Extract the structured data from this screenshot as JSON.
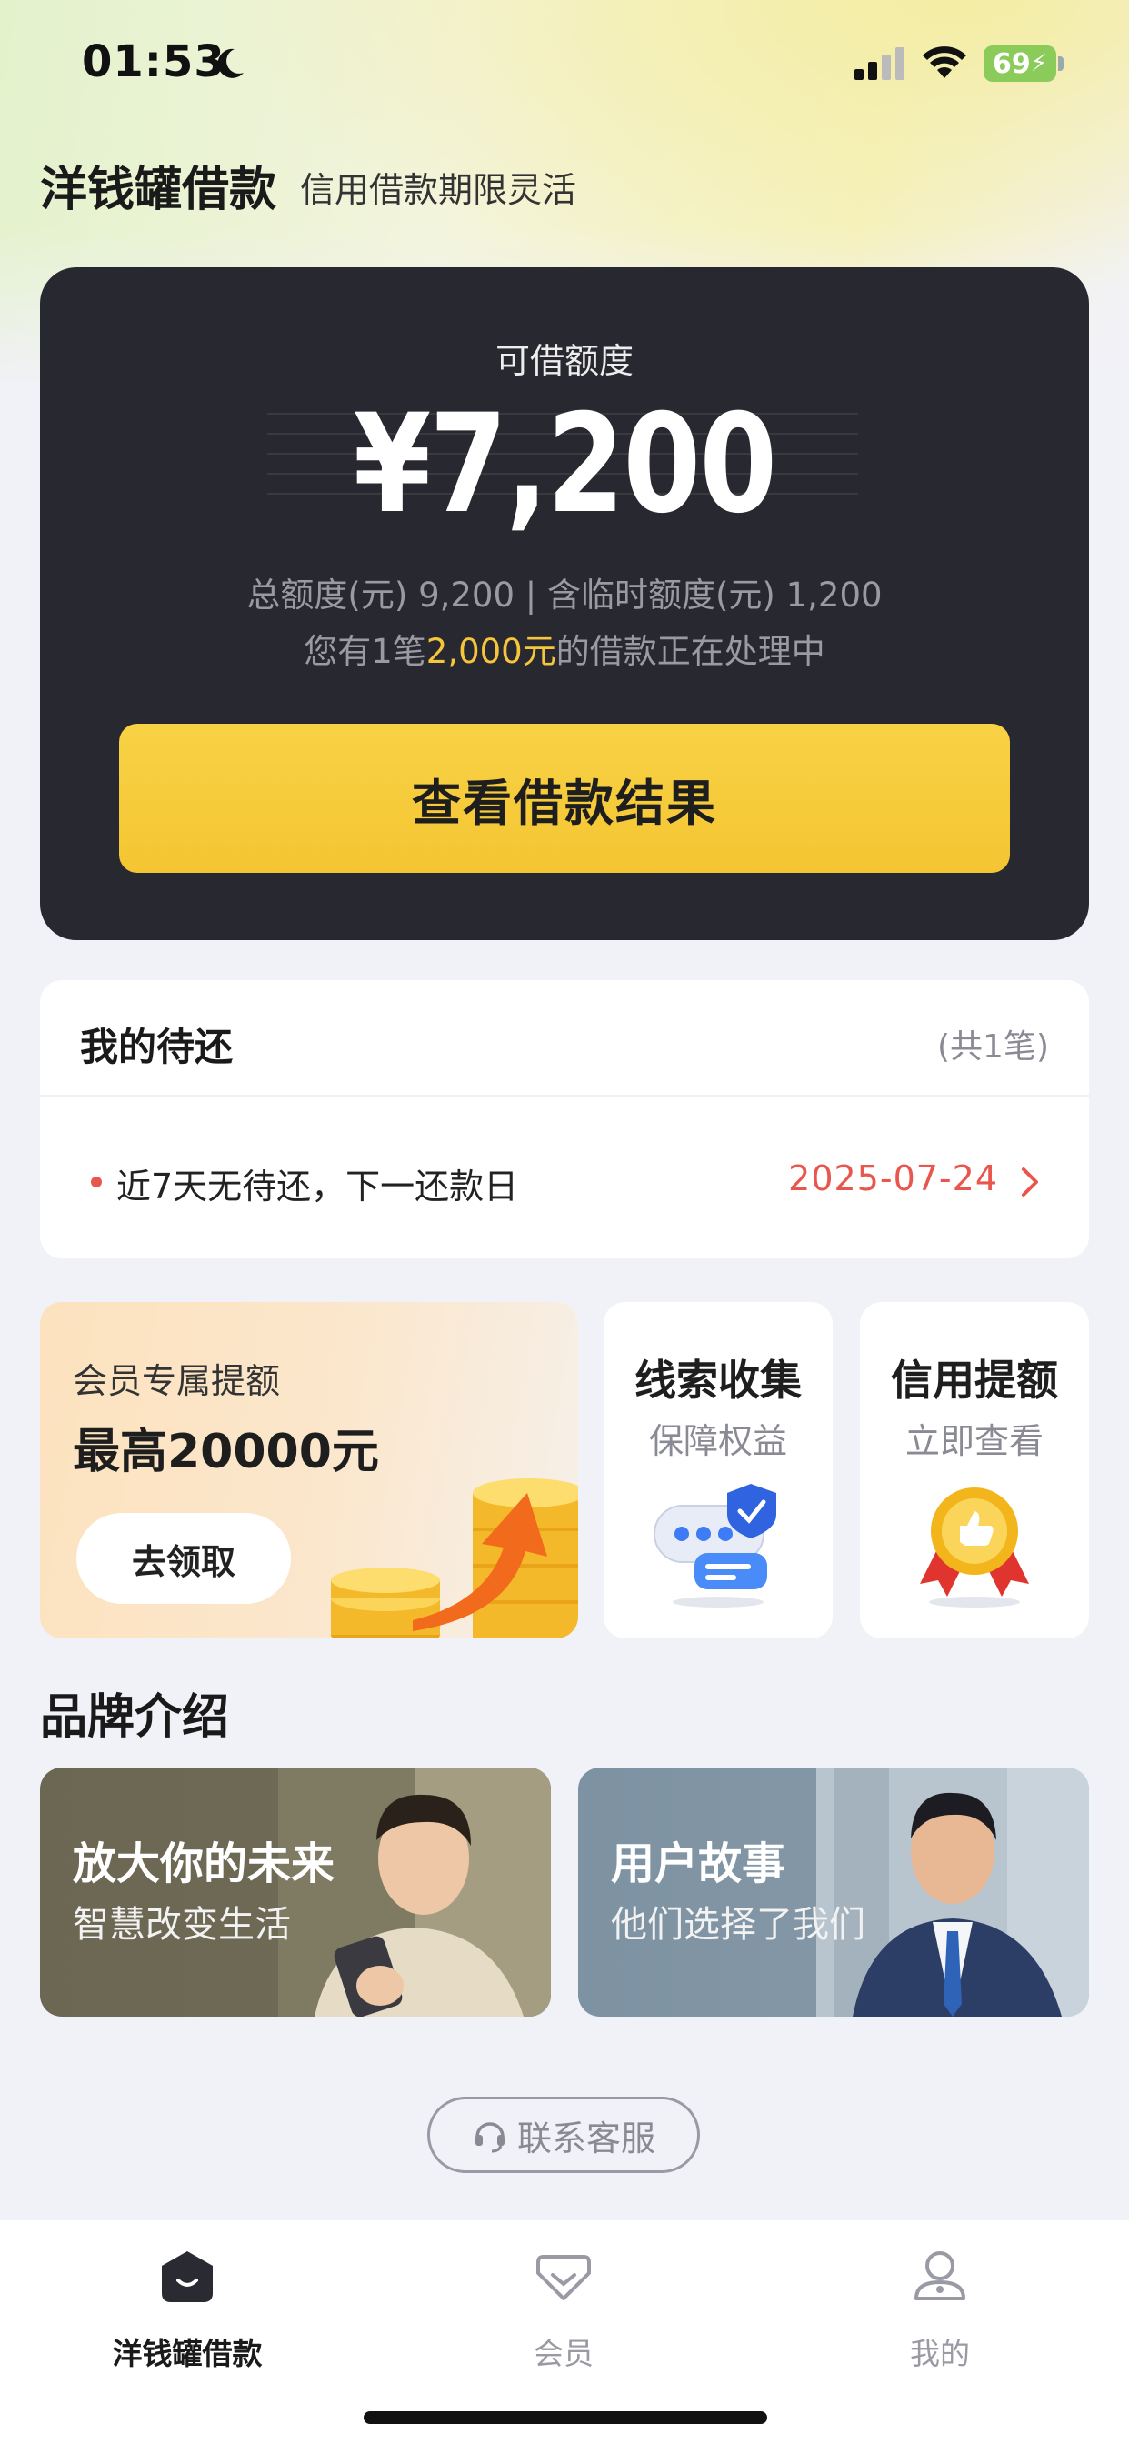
{
  "status_bar": {
    "time": "01:53",
    "battery": "69"
  },
  "header": {
    "title": "洋钱罐借款",
    "slogan": "信用借款期限灵活"
  },
  "credit": {
    "label": "可借额度",
    "amount": "¥7,200",
    "total_line": "总额度(元) 9,200 | 含临时额度(元) 1,200",
    "pending_prefix": "您有1笔",
    "pending_amount": "2,000元",
    "pending_suffix": "的借款正在处理中",
    "button": "查看借款结果"
  },
  "repayment": {
    "title": "我的待还",
    "count": "(共1笔)",
    "text": "近7天无待还，下一还款日",
    "date": "2025-07-24"
  },
  "promos": {
    "member": {
      "subtitle": "会员专属提额",
      "title": "最高20000元",
      "button": "去领取"
    },
    "clue": {
      "title": "线索收集",
      "subtitle": "保障权益"
    },
    "credit_raise": {
      "title": "信用提额",
      "subtitle": "立即查看"
    }
  },
  "brand": {
    "heading": "品牌介绍",
    "cards": [
      {
        "title": "放大你的未来",
        "subtitle": "智慧改变生活"
      },
      {
        "title": "用户故事",
        "subtitle": "他们选择了我们"
      }
    ]
  },
  "contact": {
    "label": "联系客服"
  },
  "tabs": [
    {
      "label": "洋钱罐借款"
    },
    {
      "label": "会员"
    },
    {
      "label": "我的"
    }
  ],
  "colors": {
    "accent_yellow": "#F5C53C",
    "alert_red": "#E8564E",
    "card_dark": "#282830"
  }
}
